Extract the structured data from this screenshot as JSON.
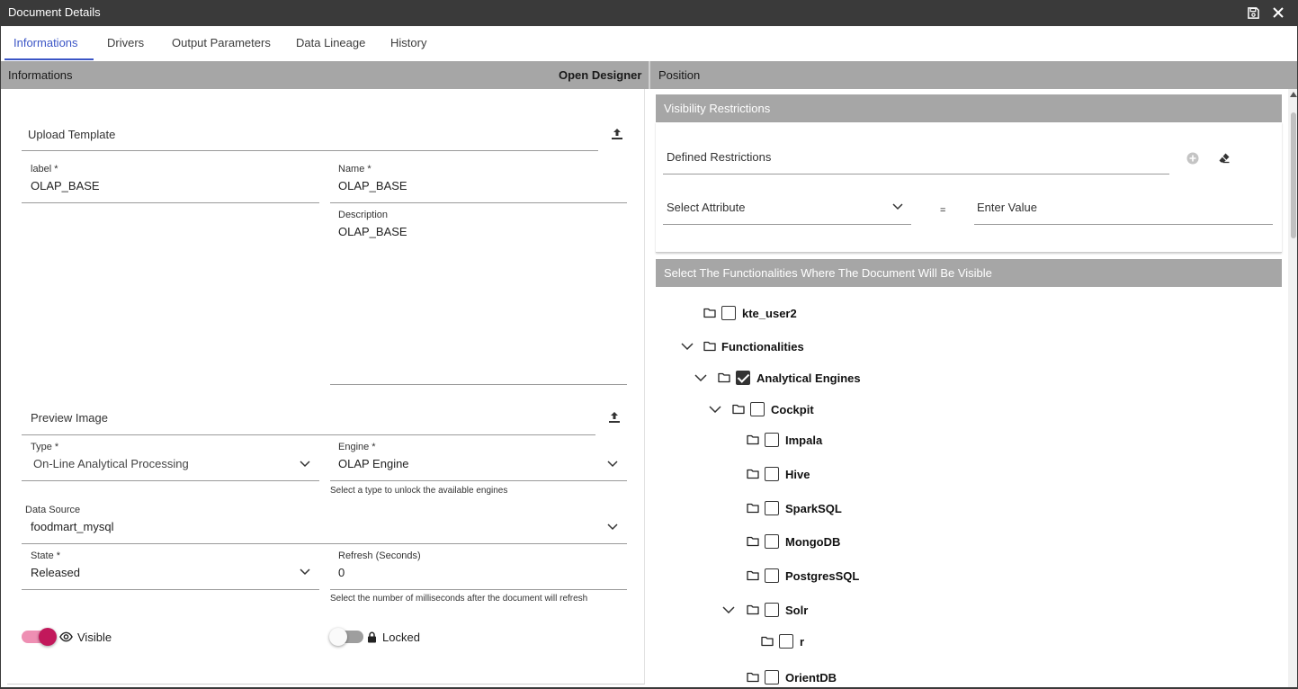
{
  "window": {
    "title": "Document Details"
  },
  "tabs": [
    "Informations",
    "Drivers",
    "Output Parameters",
    "Data Lineage",
    "History"
  ],
  "left": {
    "header": "Informations",
    "open_designer": "Open Designer",
    "upload_template": "Upload Template",
    "label": {
      "label": "label *",
      "value": "OLAP_BASE"
    },
    "name": {
      "label": "Name *",
      "value": "OLAP_BASE"
    },
    "description": {
      "label": "Description",
      "value": "OLAP_BASE"
    },
    "preview_image": "Preview Image",
    "type": {
      "label": "Type *",
      "value": "On-Line Analytical Processing"
    },
    "engine": {
      "label": "Engine *",
      "value": "OLAP Engine",
      "hint": "Select a type to unlock the available engines"
    },
    "data_source": {
      "label": "Data Source",
      "value": "foodmart_mysql"
    },
    "state": {
      "label": "State *",
      "value": "Released"
    },
    "refresh": {
      "label": "Refresh (Seconds)",
      "value": "0",
      "hint": "Select the number of milliseconds after the document will refresh"
    },
    "visible": {
      "label": "Visible",
      "on": true
    },
    "locked": {
      "label": "Locked",
      "on": false
    }
  },
  "right": {
    "header": "Position",
    "visibility": {
      "title": "Visibility Restrictions",
      "defined": "Defined Restrictions",
      "select_attribute": "Select Attribute",
      "equals": "=",
      "enter_value": "Enter Value"
    },
    "functionalities": {
      "title": "Select The Functionalities Where The Document Will Be Visible",
      "tree": [
        {
          "label": "kte_user2",
          "checked": false
        },
        {
          "label": "Functionalities",
          "checked": null
        },
        {
          "label": "Analytical Engines",
          "checked": true
        },
        {
          "label": "Cockpit",
          "checked": false
        },
        {
          "label": "Impala",
          "checked": false
        },
        {
          "label": "Hive",
          "checked": false
        },
        {
          "label": "SparkSQL",
          "checked": false
        },
        {
          "label": "MongoDB",
          "checked": false
        },
        {
          "label": "PostgresSQL",
          "checked": false
        },
        {
          "label": "Solr",
          "checked": false
        },
        {
          "label": "r",
          "checked": false
        },
        {
          "label": "OrientDB",
          "checked": false
        }
      ]
    }
  },
  "colors": {
    "accent": "#3b55c6",
    "toggle_on": "#c2185b",
    "header_gray": "#a6a6a6",
    "titlebar": "#3a3a3a"
  },
  "icons": [
    "save-icon",
    "close-icon",
    "upload-icon",
    "chevron-down-icon",
    "eye-icon",
    "lock-icon",
    "add-circle-icon",
    "eraser-icon",
    "folder-icon"
  ]
}
